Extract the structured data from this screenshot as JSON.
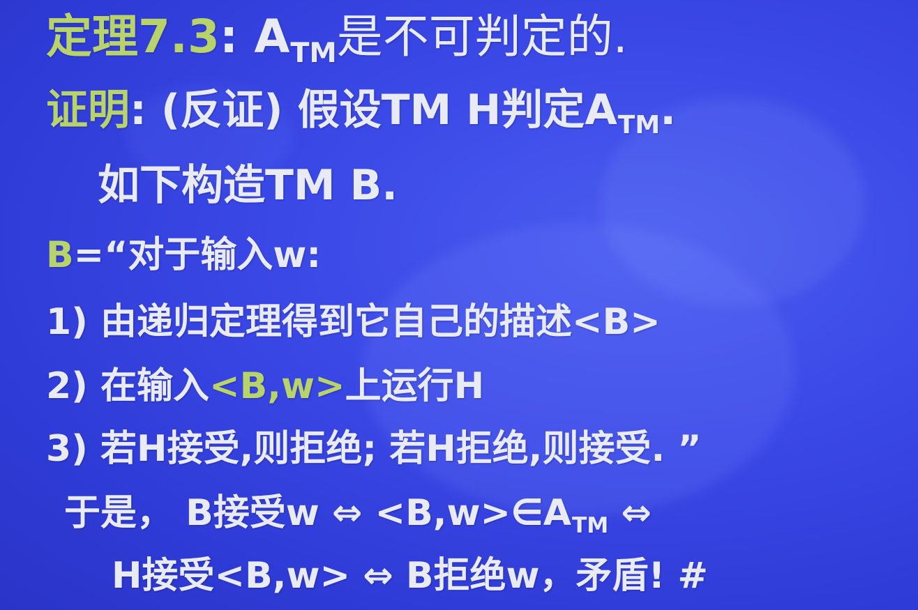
{
  "theorem": {
    "label": "定理7.3",
    "colon": ":",
    "subject": "A",
    "subscript": "TM",
    "statement": "是不可判定的."
  },
  "proof": {
    "label": "证明",
    "colon": ":",
    "intro_1": " (反证) 假设TM H判定A",
    "subscript": "TM",
    "intro_end": ".",
    "intro_2": "如下构造TM B."
  },
  "definition": {
    "var": "B",
    "text": "=“对于输入w:"
  },
  "steps": [
    {
      "num": "1)",
      "text": " 由递归定理得到它自己的描述<B>"
    },
    {
      "num": "2)",
      "pre": " 在输入",
      "highlight": "<B,w>",
      "post": "上运行H"
    },
    {
      "num": "3)",
      "text": " 若H接受,则拒绝; 若H拒绝,则接受. ”"
    }
  ],
  "conclusion": {
    "line1_pre": "于是， B接受w ⇔ <B,w>∈A",
    "line1_sub": "TM",
    "line1_post": " ⇔",
    "line2": "H接受<B,w> ⇔ B拒绝w，矛盾!   #"
  }
}
